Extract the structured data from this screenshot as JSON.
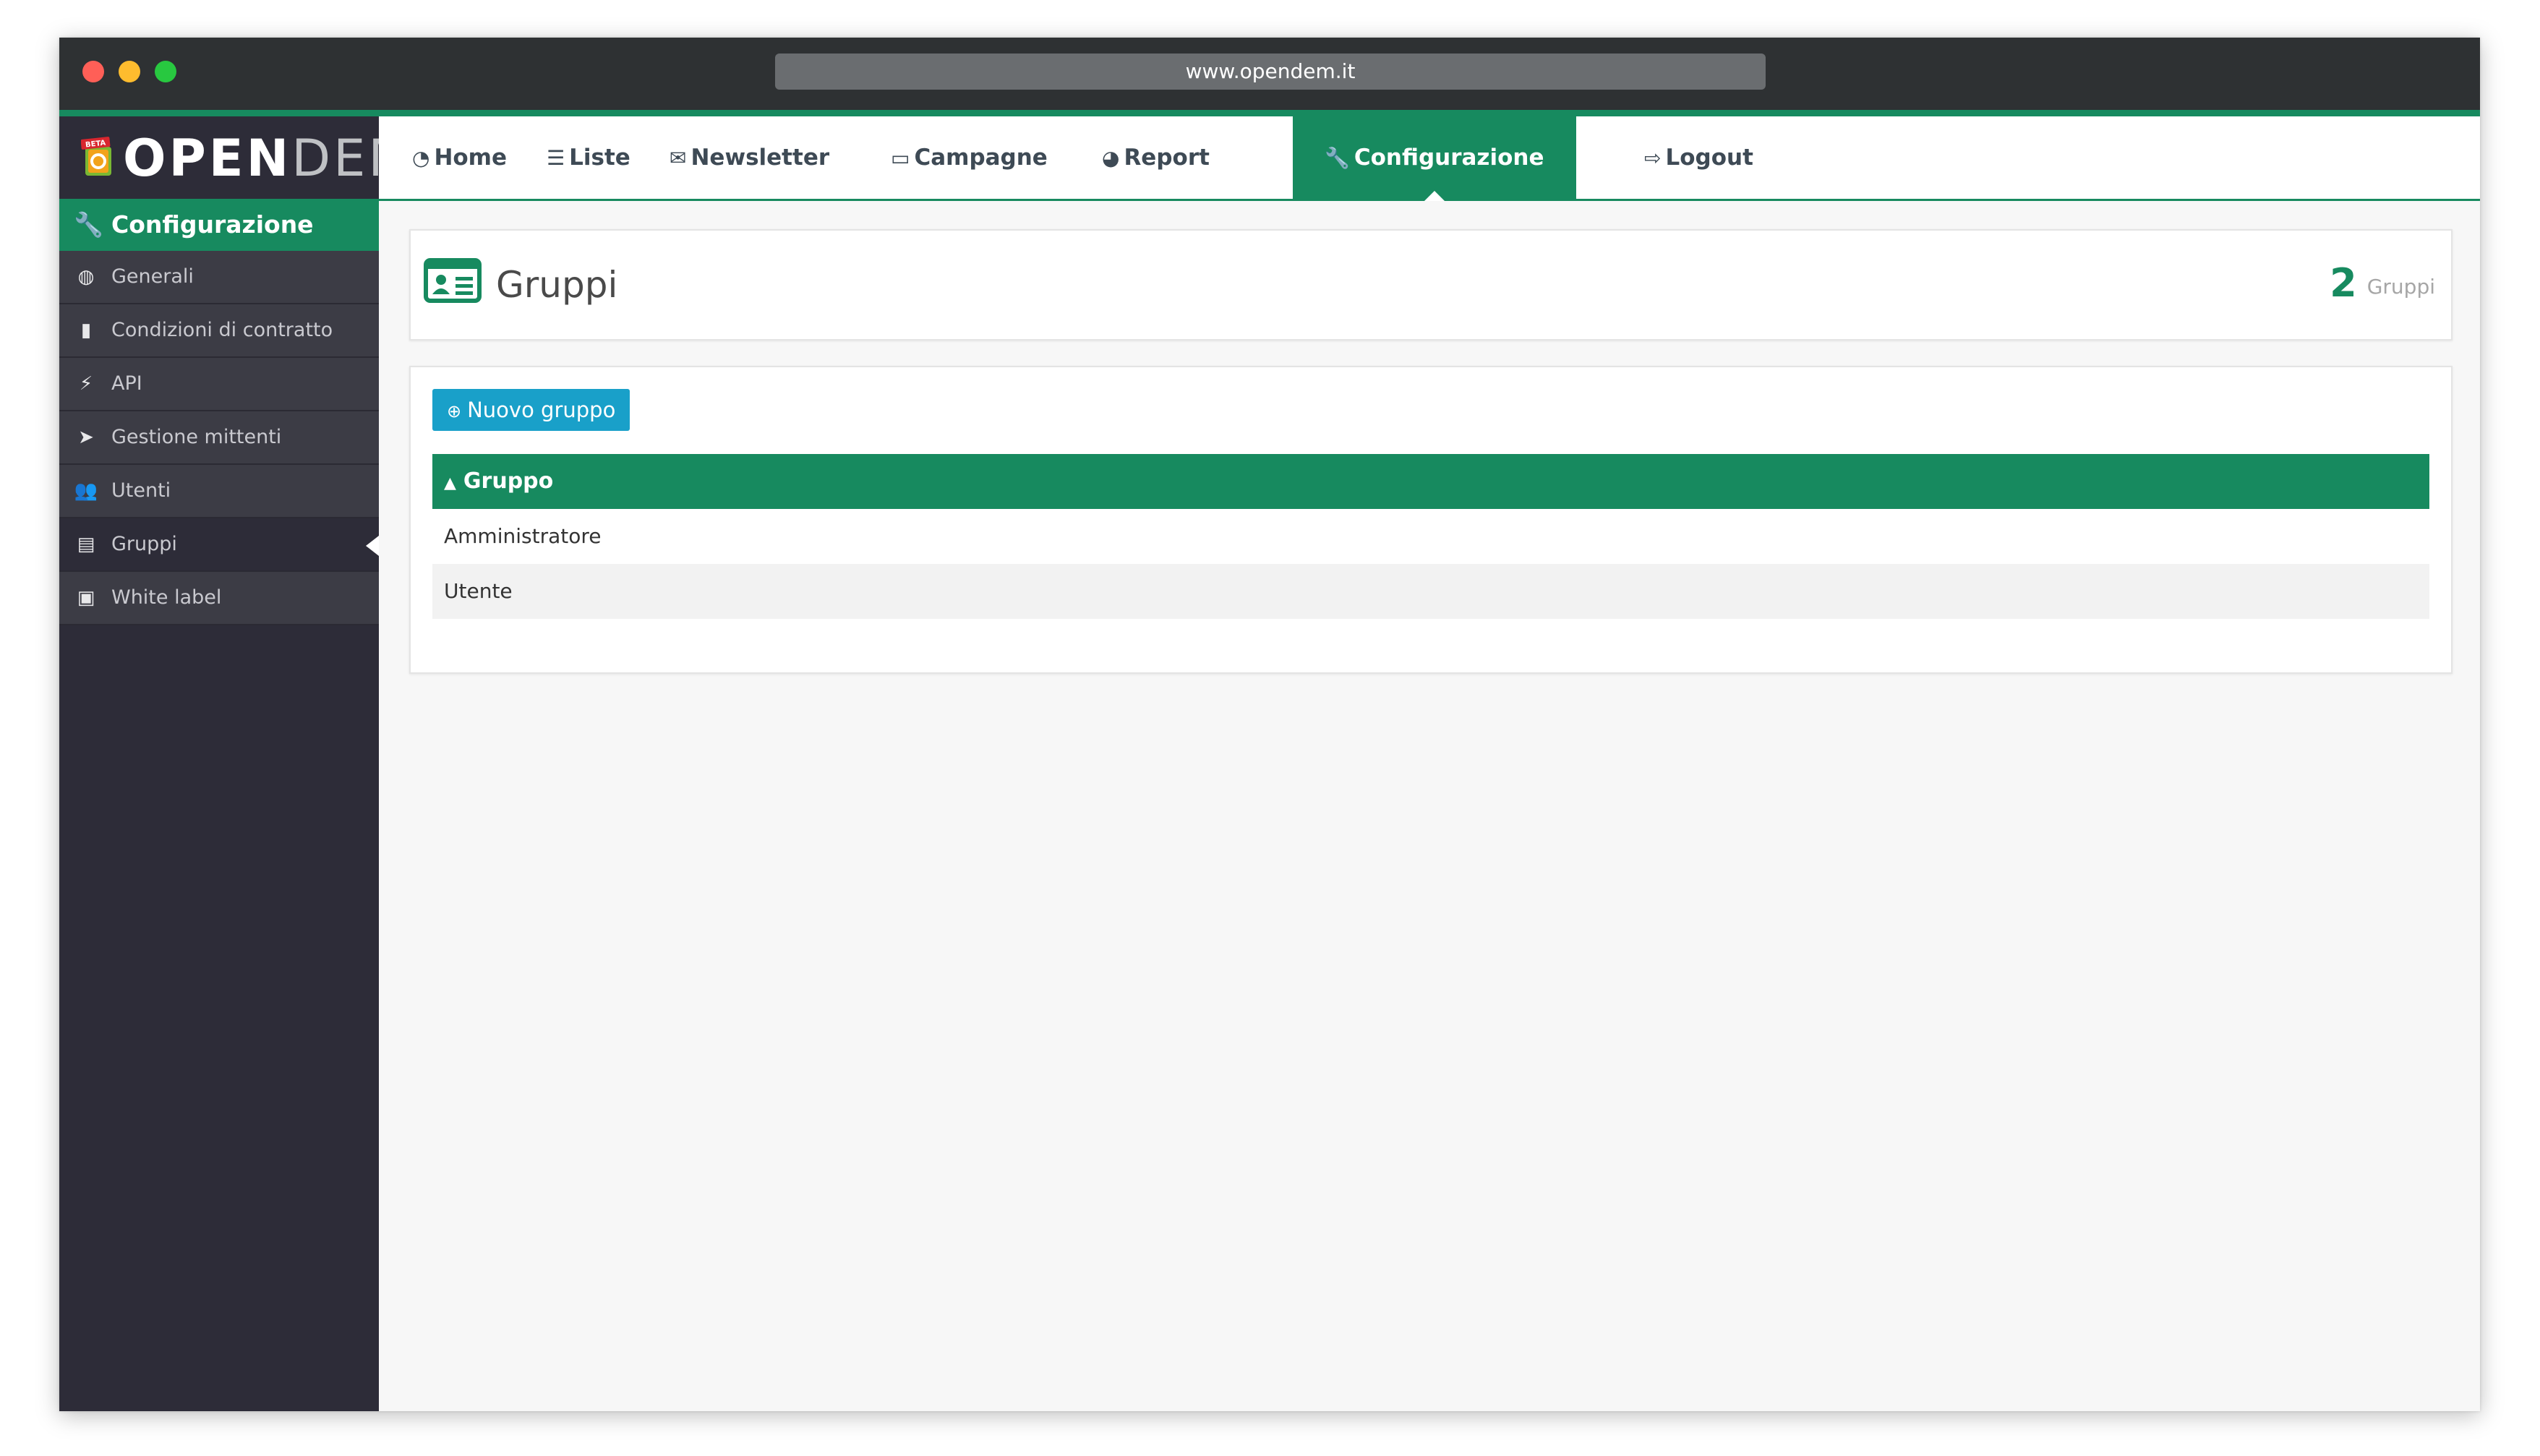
{
  "browser": {
    "url": "www.opendem.it"
  },
  "logo": {
    "badge": "BETA",
    "text_open": "OPEN",
    "text_dem": "DEM"
  },
  "sidebar": {
    "header": {
      "icon": "wrench-icon",
      "label": "Configurazione"
    },
    "items": [
      {
        "icon": "globe-icon",
        "label": "Generali",
        "active": false
      },
      {
        "icon": "file-icon",
        "label": "Condizioni di contratto",
        "active": false
      },
      {
        "icon": "plug-icon",
        "label": "API",
        "active": false
      },
      {
        "icon": "paper-plane-icon",
        "label": "Gestione mittenti",
        "active": false
      },
      {
        "icon": "users-icon",
        "label": "Utenti",
        "active": false
      },
      {
        "icon": "id-card-icon",
        "label": "Gruppi",
        "active": true
      },
      {
        "icon": "image-icon",
        "label": "White label",
        "active": false
      }
    ]
  },
  "nav": {
    "items": [
      {
        "icon": "dashboard-icon",
        "label": "Home"
      },
      {
        "icon": "list-icon",
        "label": "Liste"
      },
      {
        "icon": "envelope-icon",
        "label": "Newsletter"
      },
      {
        "icon": "folder-icon",
        "label": "Campagne"
      },
      {
        "icon": "pie-chart-icon",
        "label": "Report"
      },
      {
        "icon": "wrench-icon",
        "label": "Configurazione"
      },
      {
        "icon": "sign-out-icon",
        "label": "Logout"
      }
    ],
    "active": "Configurazione"
  },
  "page": {
    "title": "Gruppi",
    "count_value": "2",
    "count_label": "Gruppi"
  },
  "content": {
    "new_button": "Nuovo gruppo",
    "table": {
      "header": "Gruppo",
      "sort": "ascending",
      "rows": [
        "Amministratore",
        "Utente"
      ]
    }
  },
  "colors": {
    "accent": "#178a5f",
    "button": "#19a0c9",
    "sidebar": "#2d2c38",
    "sidebar_item": "#3c3c45"
  }
}
